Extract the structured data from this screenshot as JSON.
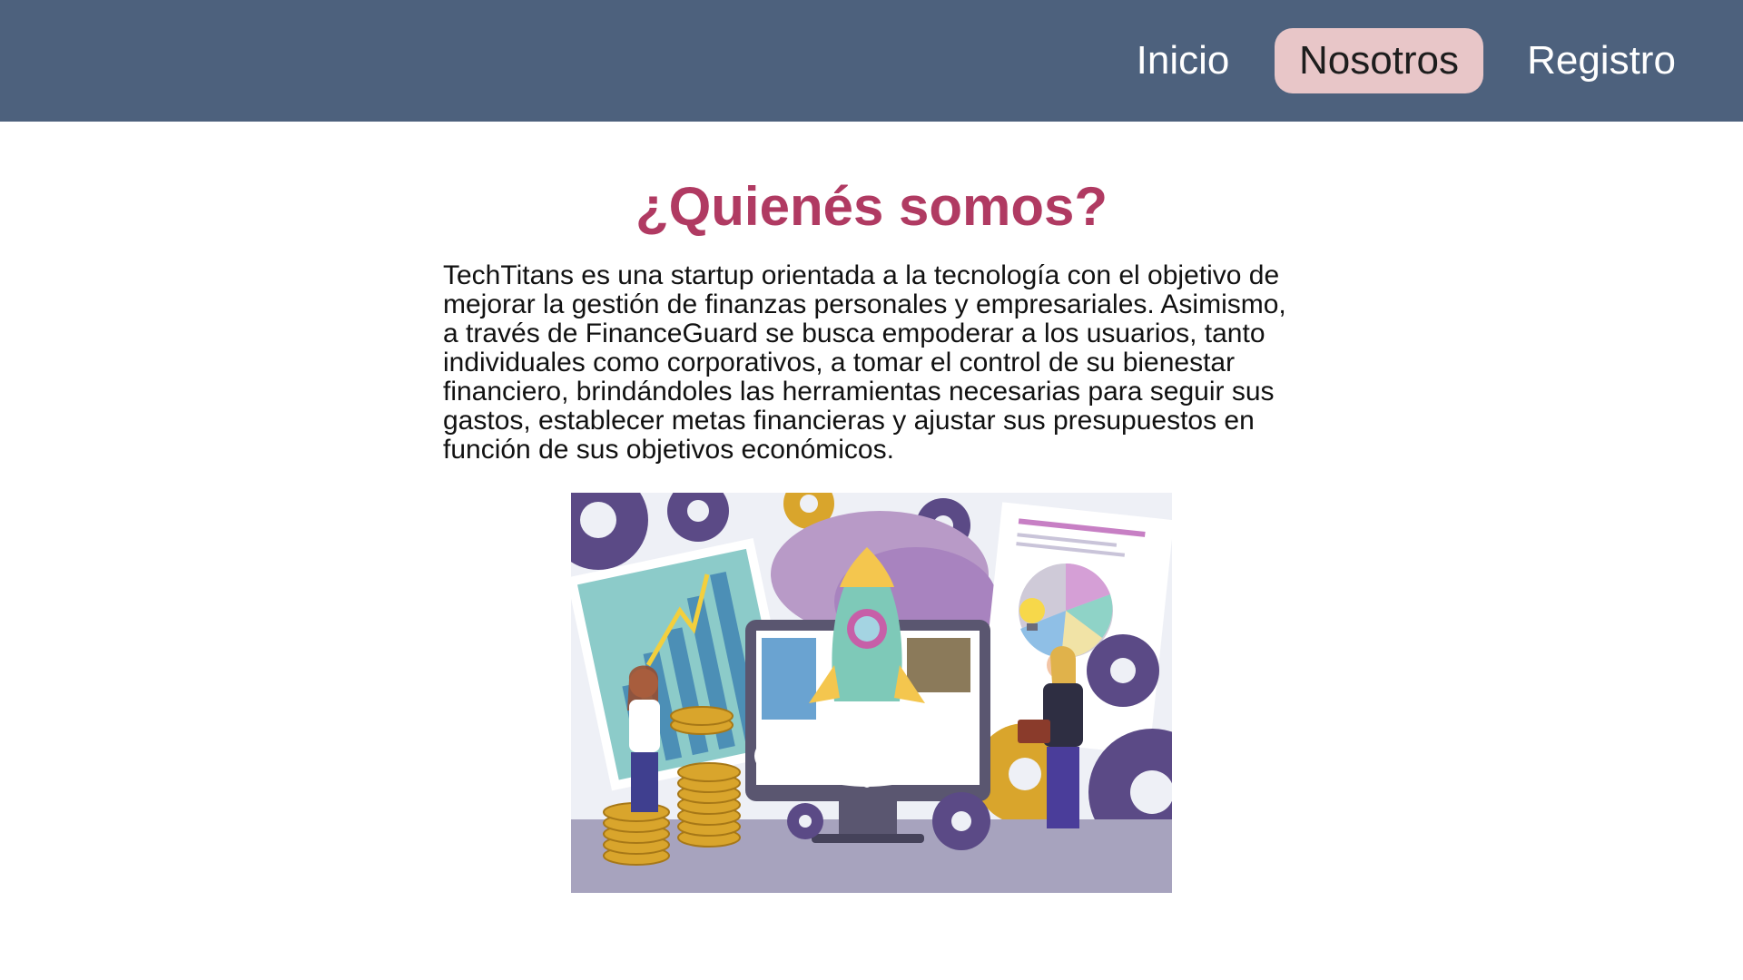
{
  "nav": {
    "items": [
      {
        "label": "Inicio",
        "active": false
      },
      {
        "label": "Nosotros",
        "active": true
      },
      {
        "label": "Registro",
        "active": false
      }
    ]
  },
  "main": {
    "title": "¿Quienés somos?",
    "paragraph": "TechTitans es una startup orientada a la tecnología con el objetivo de mejorar la gestión de finanzas personales y empresariales. Asimismo, a través de FinanceGuard se busca empoderar a los usuarios, tanto individuales como corporativos, a tomar el control de su bienestar financiero, brindándoles las herramientas necesarias para seguir sus gastos, establecer metas financieras y ajustar sus presupuestos en función de sus objetivos económicos."
  },
  "colors": {
    "navbar": "#4d617d",
    "active_tab": "#e8c6c8",
    "title": "#b03a62"
  }
}
